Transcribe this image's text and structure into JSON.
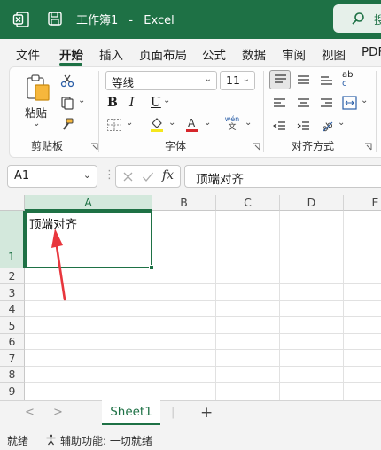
{
  "titlebar": {
    "doc_title": "工作簿1",
    "separator": "-",
    "app_name": "Excel",
    "search_label": "搜"
  },
  "tabs": [
    "文件",
    "开始",
    "插入",
    "页面布局",
    "公式",
    "数据",
    "审阅",
    "视图",
    "PDF"
  ],
  "active_tab": "开始",
  "ribbon": {
    "clipboard": {
      "paste_label": "粘贴",
      "group_label": "剪贴板"
    },
    "font": {
      "font_name": "等线",
      "font_size": "11",
      "group_label": "字体",
      "phonetic_top": "wén",
      "phonetic_bottom": "文"
    },
    "alignment": {
      "group_label": "对齐方式",
      "wrap_label": "ab",
      "wrap_sub": "c"
    }
  },
  "formula_bar": {
    "name_box": "A1",
    "fx_label": "fx",
    "content": "顶端对齐"
  },
  "grid": {
    "columns": [
      "A",
      "B",
      "C",
      "D",
      "E"
    ],
    "rows": [
      "1",
      "2",
      "3",
      "4",
      "5",
      "6",
      "7",
      "8",
      "9"
    ],
    "a1_value": "顶端对齐"
  },
  "sheets": {
    "active": "Sheet1",
    "add_label": "+",
    "prev": "<",
    "next": ">"
  },
  "status": {
    "ready": "就绪",
    "accessibility": "辅助功能: 一切就绪"
  },
  "colors": {
    "brand": "#1e7145",
    "annotation_arrow": "#e8363d"
  }
}
